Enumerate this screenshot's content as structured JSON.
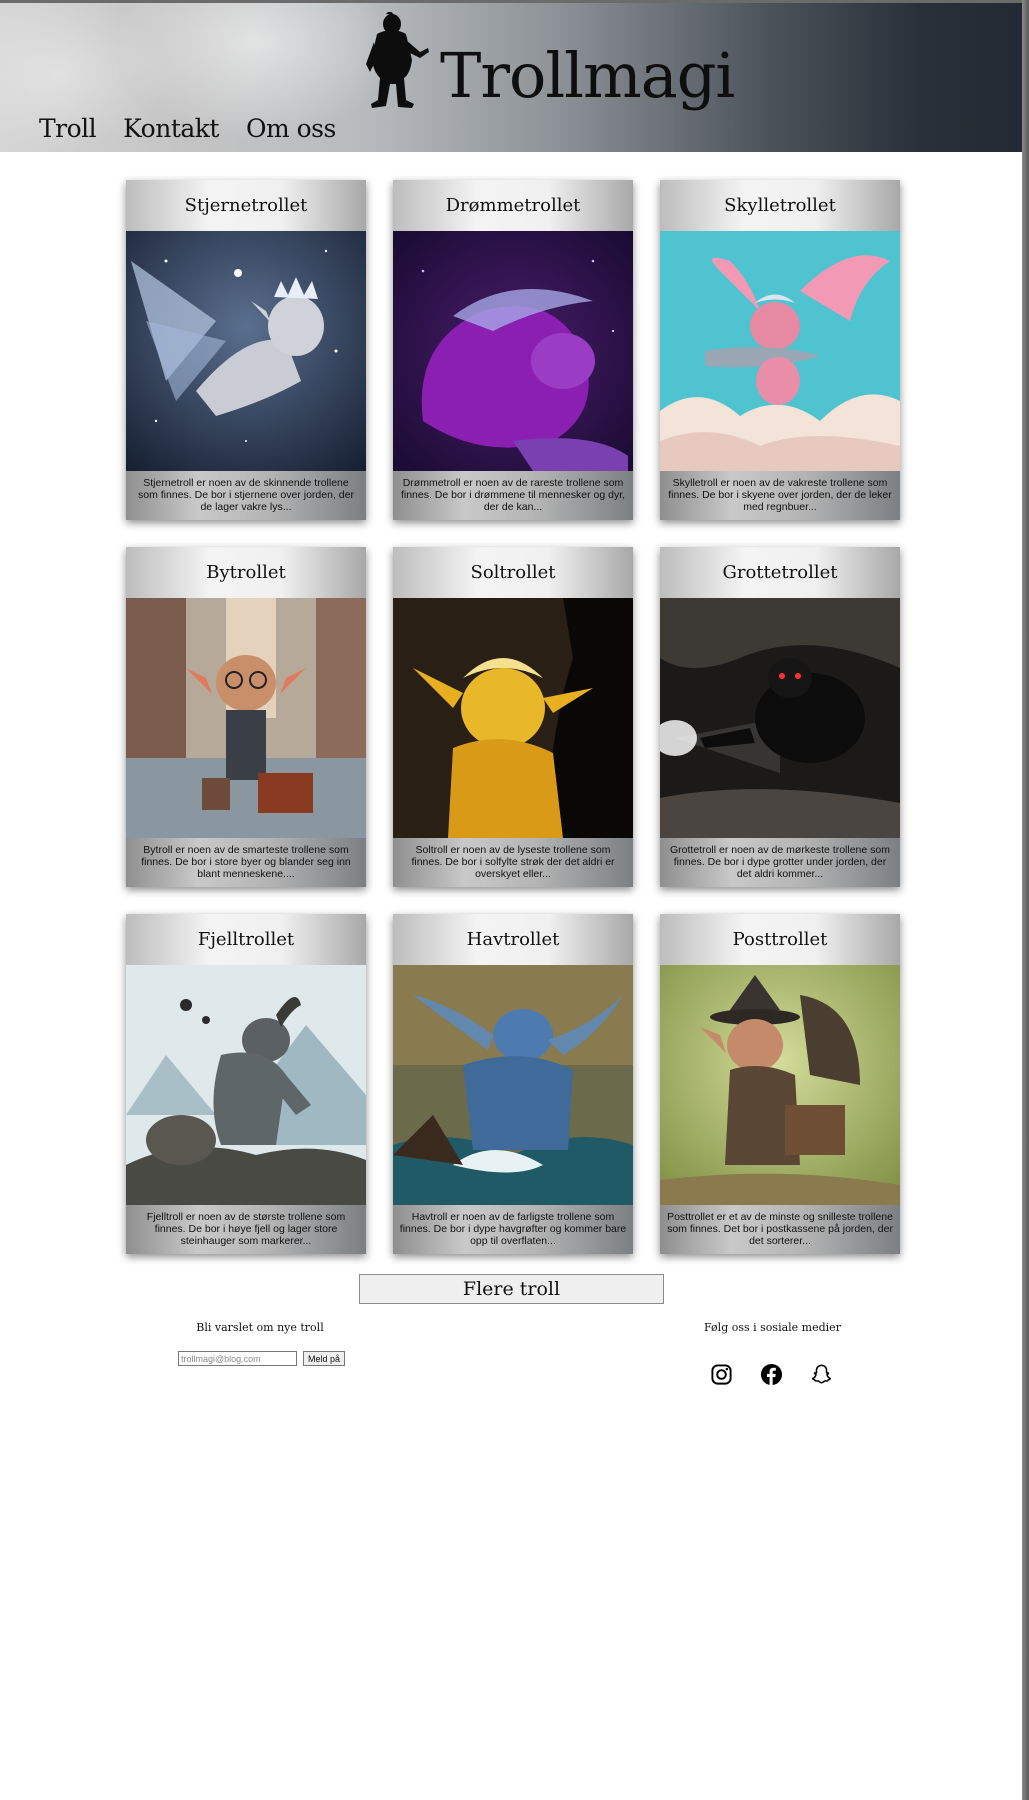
{
  "header": {
    "site_title": "Trollmagi",
    "nav": [
      {
        "label": "Troll"
      },
      {
        "label": "Kontakt"
      },
      {
        "label": "Om oss"
      }
    ]
  },
  "trolls": [
    {
      "name": "Stjernetrollet",
      "description": "Stjernetroll er noen av de skinnende trollene som finnes. De bor i stjernene over jorden, der de lager vakre lys..."
    },
    {
      "name": "Drømmetrollet",
      "description": "Drømmetroll er noen av de rareste trollene som finnes. De bor i drømmene til mennesker og dyr, der de kan..."
    },
    {
      "name": "Skylletrollet",
      "description": "Skylletroll er noen av de vakreste trollene som finnes. De bor i skyene over jorden, der de leker med regnbuer..."
    },
    {
      "name": "Bytrollet",
      "description": "Bytroll er noen av de smarteste trollene som finnes. De bor i store byer og blander seg inn blant menneskene...."
    },
    {
      "name": "Soltrollet",
      "description": "Soltroll er noen av de lyseste trollene som finnes. De bor i solfylte strøk der det aldri er overskyet eller..."
    },
    {
      "name": "Grottetrollet",
      "description": "Grottetroll er noen av de mørkeste trollene som finnes. De bor i dype grotter under jorden, der det aldri kommer..."
    },
    {
      "name": "Fjelltrollet",
      "description": "Fjelltroll er noen av de største trollene som finnes. De bor i høye fjell og lager store steinhauger som markerer..."
    },
    {
      "name": "Havtrollet",
      "description": "Havtroll er noen av de farligste trollene som finnes. De bor i dype havgrøfter og kommer bare opp til overflaten..."
    },
    {
      "name": "Posttrollet",
      "description": "Posttrollet er et av de minste og snilleste trollene som finnes. Det bor i postkassene på jorden, der det sorterer..."
    }
  ],
  "more_button": "Flere troll",
  "newsletter": {
    "title": "Bli varslet om nye troll",
    "placeholder": "trollmagi@blog.com",
    "button": "Meld på"
  },
  "social": {
    "title": "Følg oss i sosiale medier",
    "icons": [
      "instagram-icon",
      "facebook-icon",
      "snapchat-icon"
    ]
  }
}
